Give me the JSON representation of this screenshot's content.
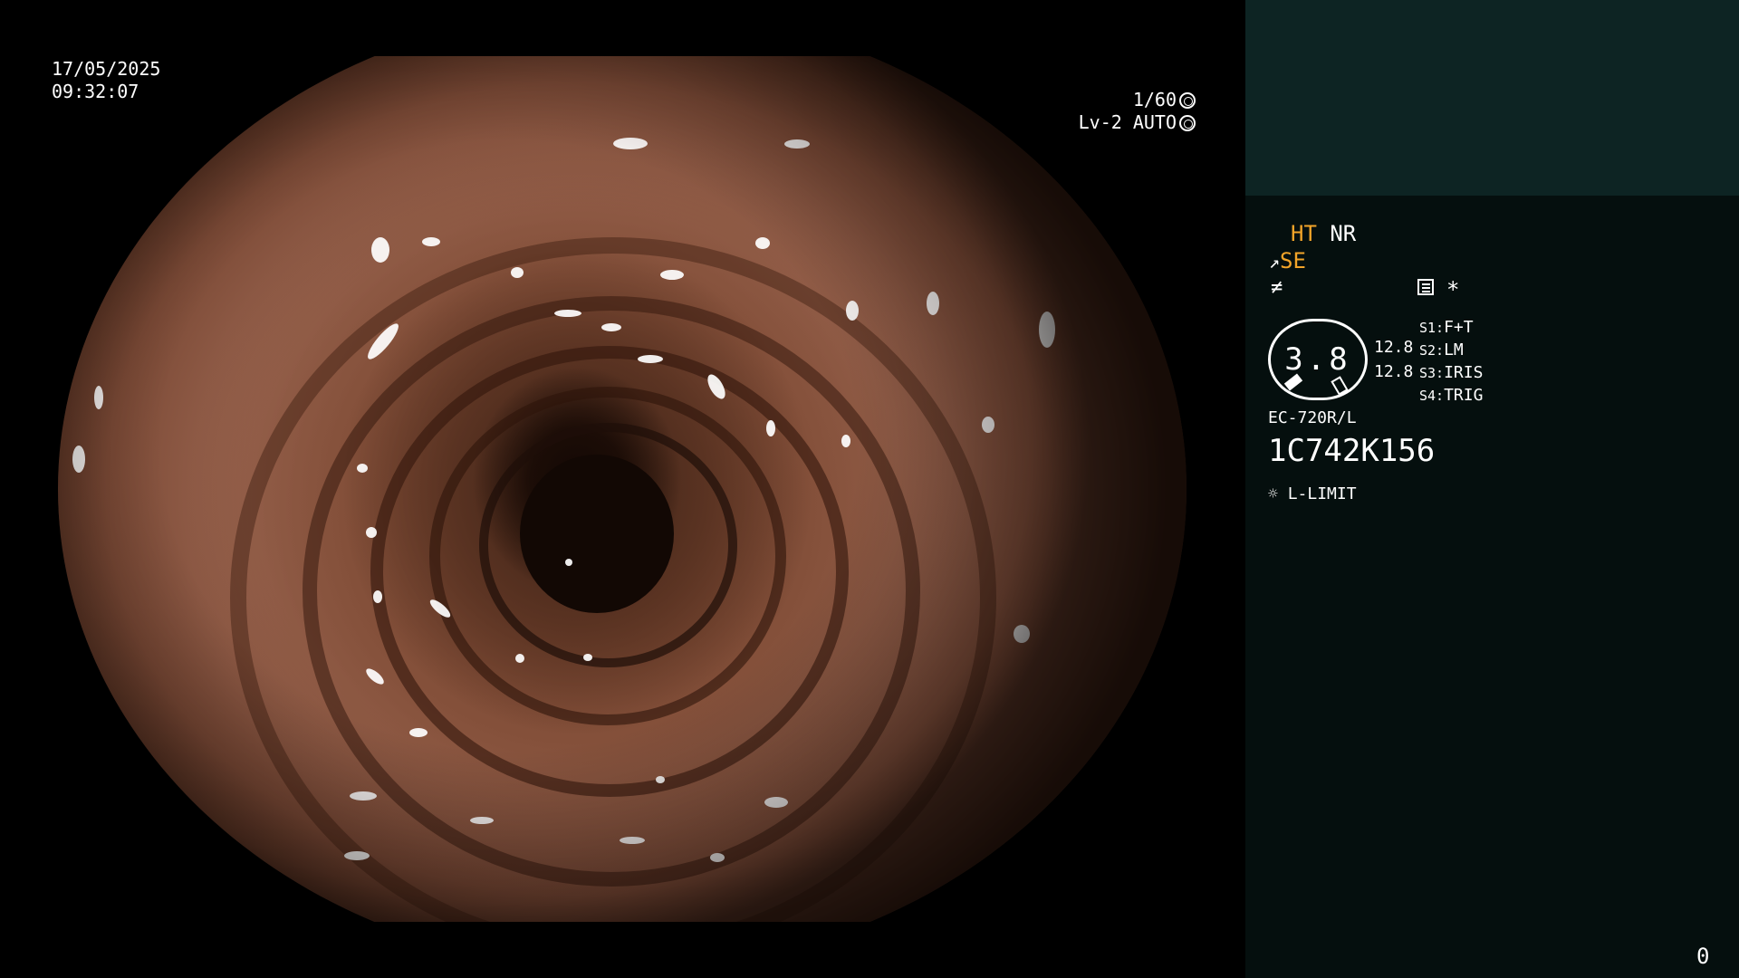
{
  "overlay": {
    "date": "17/05/2025",
    "time": "09:32:07",
    "shutter": "1/60",
    "level_mode": "Lv-2 AUTO"
  },
  "panel": {
    "ht": "HT",
    "nr": "NR",
    "se": "SE",
    "gauge_value": "3.8",
    "readout_1": "12.8",
    "readout_2": "12.8",
    "switches": [
      {
        "key": "S1:",
        "value": "F+T"
      },
      {
        "key": "S2:",
        "value": "LM"
      },
      {
        "key": "S3:",
        "value": "IRIS"
      },
      {
        "key": "S4:",
        "value": "TRIG"
      }
    ],
    "scope_model": "EC-720R/L",
    "serial": "1C742K156",
    "light_mode": "L-LIMIT",
    "counter": "0",
    "asterisk": "*"
  },
  "colors": {
    "accent_orange": "#f2a429",
    "panel_bg": "#050f0e",
    "panel_top_bg": "#0d2423"
  },
  "icons": {
    "shutter": "aperture-icon",
    "auto": "iris-icon",
    "se": "scope-tip-icon",
    "filter": "filter-icon",
    "menu": "menu-icon",
    "light": "lamp-icon"
  }
}
